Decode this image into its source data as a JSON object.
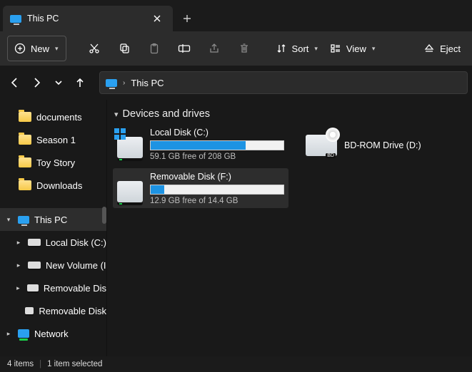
{
  "tab": {
    "title": "This PC"
  },
  "toolbar": {
    "new": "New",
    "sort": "Sort",
    "view": "View",
    "eject": "Eject"
  },
  "address": {
    "location": "This PC"
  },
  "quickaccess": [
    {
      "label": "documents"
    },
    {
      "label": "Season 1"
    },
    {
      "label": "Toy Story"
    },
    {
      "label": "Downloads"
    }
  ],
  "tree": {
    "this_pc": "This PC",
    "local_disk": "Local Disk (C:)",
    "new_volume": "New Volume (I",
    "removable1": "Removable Dis",
    "removable2": "Removable Disk",
    "network": "Network"
  },
  "group_header": "Devices and drives",
  "drives": {
    "c": {
      "name": "Local Disk (C:)",
      "free": "59.1 GB free of 208 GB",
      "pct": 71.6
    },
    "d": {
      "name": "BD-ROM Drive (D:)"
    },
    "f": {
      "name": "Removable Disk (F:)",
      "free": "12.9 GB free of 14.4 GB",
      "pct": 10.4
    }
  },
  "status": {
    "items": "4 items",
    "selected": "1 item selected"
  }
}
